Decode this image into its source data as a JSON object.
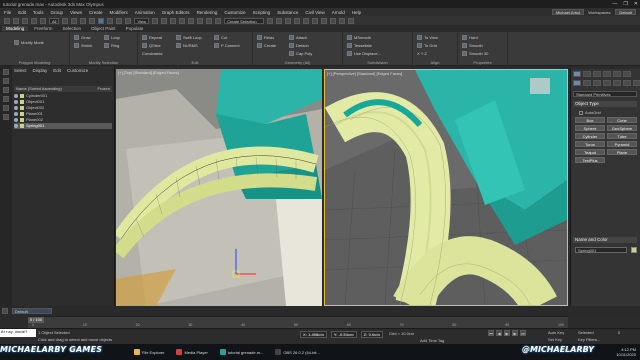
{
  "window": {
    "title": "tutorial grenade.max - Autodesk 3ds Max Olympus",
    "controls": [
      "—",
      "❐",
      "✕"
    ]
  },
  "menubar": {
    "items": [
      "File",
      "Edit",
      "Tools",
      "Group",
      "Views",
      "Create",
      "Modifiers",
      "Animation",
      "Graph Editors",
      "Rendering",
      "Customize",
      "Scripting",
      "Substance",
      "Civil View",
      "Arnold",
      "Help"
    ],
    "user": "Michael.Arbul",
    "workspaces_label": "Workspaces:",
    "workspace": "Default"
  },
  "toolbar": {
    "filter": "All",
    "view": "View",
    "selection_set": "Create Selection Se"
  },
  "ribbon": {
    "tabs": [
      "Modeling",
      "Freeform",
      "Selection",
      "Object Paint",
      "Populate"
    ],
    "active_tab": "Modeling",
    "groups": {
      "polygon_modeling": {
        "label": "Polygon Modeling",
        "items": [
          "Modify Mode"
        ]
      },
      "modify_selection": {
        "label": "Modify Selection",
        "items": [
          "Grow",
          "Shrink",
          "Loop",
          "Ring"
        ]
      },
      "edit": {
        "label": "Edit",
        "items": [
          "Repeat",
          "QSlice",
          "Swift Loop",
          "NURMS",
          "Cut",
          "P Connect",
          "Constraints:"
        ]
      },
      "geometry": {
        "label": "Geometry (All)",
        "items": [
          "Relax",
          "Create",
          "Attach",
          "Detach",
          "Cap Poly"
        ]
      },
      "subdivision": {
        "label": "Subdivision",
        "items": [
          "MSmooth",
          "Tessellate",
          "Use Displace..."
        ]
      },
      "align": {
        "label": "Align",
        "items": [
          "To View",
          "To Grid",
          "X Y Z"
        ]
      },
      "properties": {
        "label": "Properties",
        "items": [
          "Hard",
          "Smooth",
          "Smooth 30"
        ]
      }
    }
  },
  "scene_explorer": {
    "tabs": [
      "Select",
      "Display",
      "Edit",
      "Customize"
    ],
    "column_header": "Name (Sorted Ascending)",
    "frozen_label": "Frozen",
    "rows": [
      {
        "name": "Cylinder001",
        "selected": false
      },
      {
        "name": "Object001",
        "selected": false
      },
      {
        "name": "Object002",
        "selected": false
      },
      {
        "name": "Plane001",
        "selected": false
      },
      {
        "name": "Plane002",
        "selected": false
      },
      {
        "name": "Spring001",
        "selected": true
      }
    ],
    "layer": "Default"
  },
  "viewports": {
    "left_label": "[+] [Top] [Standard] [Edged Faces]",
    "right_label": "[+] [Perspective] [Standard] [Edged Faces]"
  },
  "command_panel": {
    "category": "Standard Primitives",
    "object_type_header": "Object Type",
    "autogrid_label": "AutoGrid",
    "buttons": [
      "Box",
      "Cone",
      "Sphere",
      "GeoSphere",
      "Cylinder",
      "Tube",
      "Torus",
      "Pyramid",
      "Teapot",
      "Plane",
      "TextPlus"
    ],
    "name_color_header": "Name and Color",
    "object_name": "Spring001",
    "object_color": "#c8d28a"
  },
  "timeline": {
    "slider": "0 / 100",
    "ticks": [
      "0",
      "10",
      "20",
      "30",
      "40",
      "50",
      "60",
      "70",
      "80",
      "90",
      "100"
    ]
  },
  "statusbar": {
    "maxscript": "Array mode?",
    "objects_selected": "1 Object Selected",
    "prompt": "Click and drag to select and move objects",
    "x_label": "X:",
    "x": "1.498cm",
    "y_label": "Y:",
    "y": "-0.54cm",
    "z_label": "Z:",
    "z": "0.0cm",
    "grid": "Grid = 10.0cm",
    "add_time_tag": "Add Time Tag",
    "auto_key": "Auto Key",
    "selected": "Selected",
    "set_key": "Set Key",
    "key_filters": "Key Filters...",
    "frame": "0"
  },
  "taskbar": {
    "items": [
      {
        "label": "File Explorer",
        "color": "#e8b840"
      },
      {
        "label": "Media Player",
        "color": "#d04040"
      },
      {
        "label": "tutorial grenade.m...",
        "color": "#2aa198"
      },
      {
        "label": "OBS 26.0.2 (64-bit...",
        "color": "#444"
      }
    ],
    "time": "4:12 PM",
    "date": "10/11/2020"
  },
  "branding": {
    "left": "MICHAELARBY GAMES",
    "right": "@MICHAELARBY"
  }
}
